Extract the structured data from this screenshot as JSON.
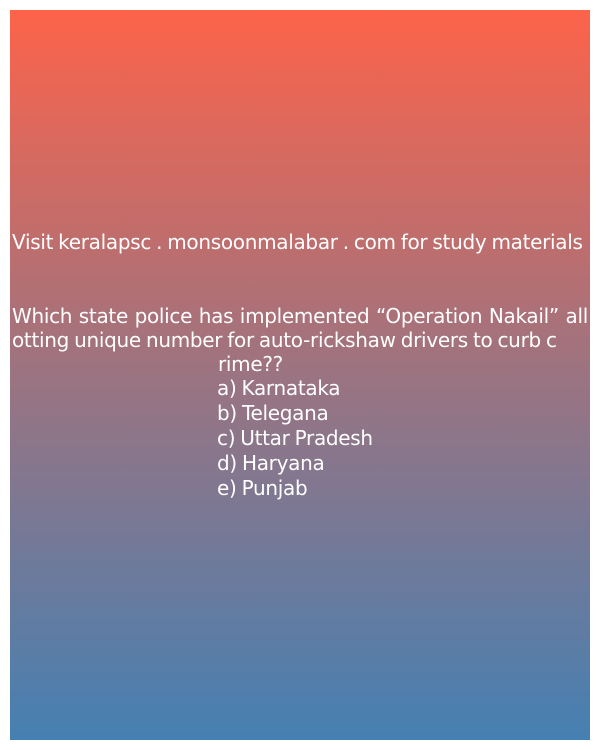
{
  "promo": {
    "text": "Visit keralapsc . monsoonmalabar . com for study materials"
  },
  "question": {
    "text": " Which state police has implemented “Operation Nakail” allotting unique number for auto-rickshaw drivers to curb c",
    "tail": "rime??"
  },
  "options": [
    "a) Karnataka",
    "b) Telegana",
    "c) Uttar Pradesh",
    "d) Haryana",
    "e) Punjab"
  ],
  "colors": {
    "gradient_top": "#fd634a",
    "gradient_bottom": "#4580b2",
    "text": "#ffffff"
  }
}
